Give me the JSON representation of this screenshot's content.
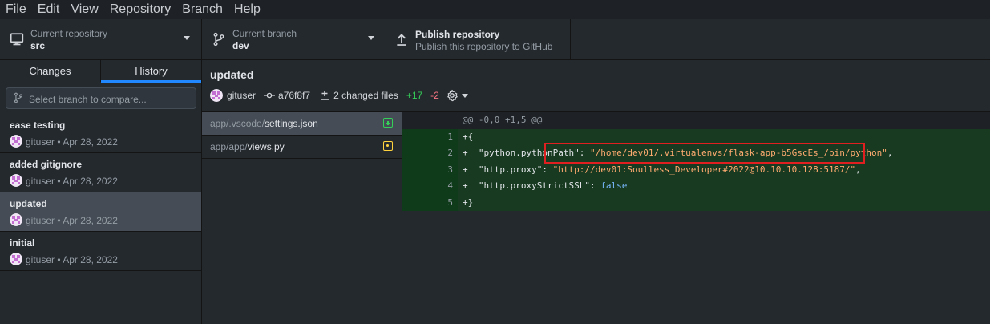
{
  "menu": [
    "File",
    "Edit",
    "View",
    "Repository",
    "Branch",
    "Help"
  ],
  "toolbar": {
    "repo_label": "Current repository",
    "repo_value": "src",
    "branch_label": "Current branch",
    "branch_value": "dev",
    "publish_title": "Publish repository",
    "publish_sub": "Publish this repository to GitHub"
  },
  "tabs": {
    "changes": "Changes",
    "history": "History",
    "active": "History"
  },
  "compare": {
    "placeholder": "Select branch to compare..."
  },
  "commits": [
    {
      "title": "ease testing",
      "meta": "gituser • Apr 28, 2022",
      "selected": false
    },
    {
      "title": "added gitignore",
      "meta": "gituser • Apr 28, 2022",
      "selected": false
    },
    {
      "title": "updated",
      "meta": "gituser • Apr 28, 2022",
      "selected": true
    },
    {
      "title": "initial",
      "meta": "gituser • Apr 28, 2022",
      "selected": false
    }
  ],
  "commit_detail": {
    "title": "updated",
    "author": "gituser",
    "sha": "a76f8f7",
    "changed_files": "2 changed files",
    "additions": "+17",
    "deletions": "-2"
  },
  "files": [
    {
      "dir": "app/.vscode/",
      "name": "settings.json",
      "status": "added",
      "selected": true
    },
    {
      "dir": "app/app/",
      "name": "views.py",
      "status": "modified",
      "selected": false
    }
  ],
  "diff": {
    "hunk": "@@ -0,0 +1,5 @@",
    "lines": [
      {
        "num": "1",
        "text": "+{"
      },
      {
        "num": "2",
        "prefix": "+  ",
        "key": "\"python.pythonPath\"",
        "sep": ": ",
        "value": "\"/home/dev01/.virtualenvs/flask-app-b5GscEs_/bin/python\"",
        "tail": ","
      },
      {
        "num": "3",
        "prefix": "+  ",
        "key": "\"http.proxy\"",
        "sep": ": ",
        "value": "\"http://dev01:Soulless_Developer#2022@10.10.10.128:5187/\"",
        "tail": ","
      },
      {
        "num": "4",
        "prefix": "+  ",
        "key": "\"http.proxyStrictSSL\"",
        "sep": ": ",
        "value_kw": "false",
        "tail": ""
      },
      {
        "num": "5",
        "text": "+}"
      }
    ]
  },
  "colors": {
    "accent": "#2188ff",
    "added": "#34d058",
    "removed": "#f97583",
    "modified": "#ffd33d",
    "highlight": "#e02020"
  }
}
